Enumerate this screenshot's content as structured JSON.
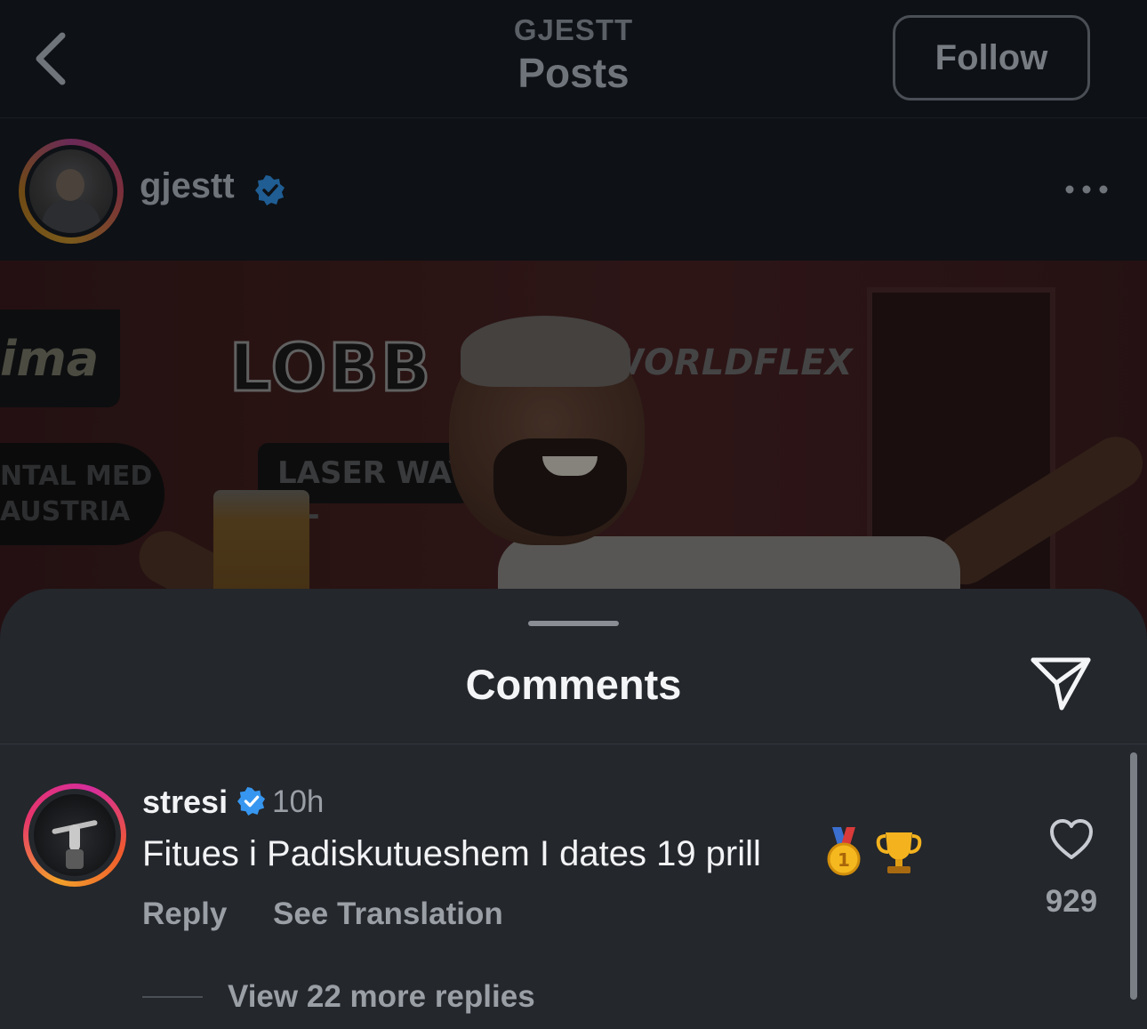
{
  "nav": {
    "account": "GJESTT",
    "title": "Posts",
    "follow_label": "Follow"
  },
  "post": {
    "username": "gjestt",
    "verified": true,
    "media_signs": {
      "lobb": "LOBB",
      "worldflex": "WORLDFLEX",
      "laser": "LASER WAY CL",
      "dental_1": "NTAL MED",
      "dental_2": "AUSTRIA",
      "ima": "ima"
    }
  },
  "comments_sheet": {
    "title": "Comments",
    "comments": [
      {
        "username": "stresi",
        "verified": true,
        "time": "10h",
        "text": "Fitues i Padiskutueshem I dates 19 prill",
        "emojis": [
          "medal-icon",
          "trophy-icon"
        ],
        "reply_label": "Reply",
        "translate_label": "See Translation",
        "like_count": "929",
        "view_replies_label": "View 22 more replies"
      }
    ]
  },
  "colors": {
    "background": "#0c0f13",
    "sheet": "#24272c",
    "verified_blue": "#3797f0",
    "muted_text": "#9a9ea5"
  }
}
